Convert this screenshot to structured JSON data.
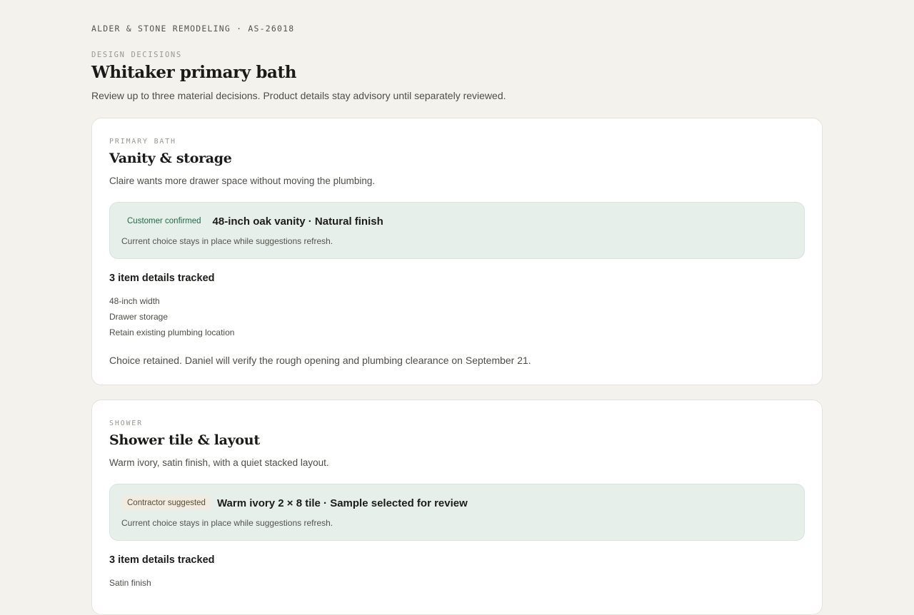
{
  "header": {
    "company": "ALDER & STONE REMODELING · AS-26018",
    "eyebrow": "DESIGN DECISIONS",
    "title": "Whitaker primary bath",
    "subtitle": "Review up to three material decisions. Product details stay advisory until separately reviewed."
  },
  "decisions": [
    {
      "area": "PRIMARY BATH",
      "title": "Vanity & storage",
      "description": "Claire wants more drawer space without moving the plumbing.",
      "status_badge": "Customer confirmed",
      "choice": "48-inch oak vanity · Natural finish",
      "choice_note": "Current choice stays in place while suggestions refresh.",
      "tracked_label": "3 item details tracked",
      "details": [
        "48-inch width",
        "Drawer storage",
        "Retain existing plumbing location"
      ],
      "outcome": "Choice retained. Daniel will verify the rough opening and plumbing clearance on September 21."
    },
    {
      "area": "SHOWER",
      "title": "Shower tile & layout",
      "description": "Warm ivory, satin finish, with a quiet stacked layout.",
      "status_badge": "Contractor suggested",
      "choice": "Warm ivory 2 × 8 tile · Sample selected for review",
      "choice_note": "Current choice stays in place while suggestions refresh.",
      "tracked_label": "3 item details tracked",
      "details": [
        "Satin finish"
      ]
    }
  ],
  "colors": {
    "background": "#f4f2ed",
    "card": "#ffffff",
    "choice_panel": "#e7efea",
    "confirmed_badge_text": "#1f6a45",
    "suggested_badge_text": "#5a4a36"
  }
}
